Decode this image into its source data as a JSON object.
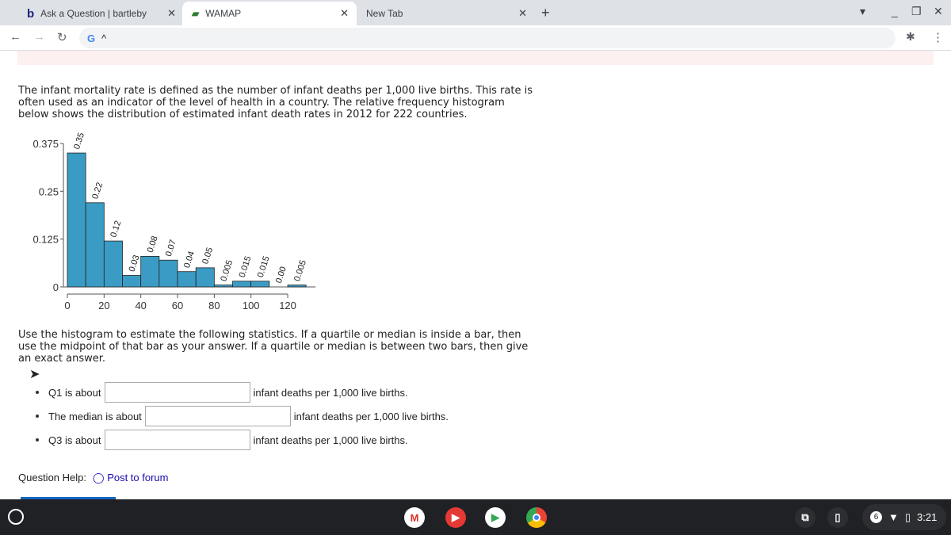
{
  "browser": {
    "tabs": [
      {
        "label": "Ask a Question | bartleby",
        "icon": "b"
      },
      {
        "label": "WAMAP",
        "active": true
      },
      {
        "label": "New Tab"
      }
    ],
    "omnibox": "^"
  },
  "intro": "The infant mortality rate is defined as the number of infant deaths per 1,000 live births. This rate is often used as an indicator of the level of health in a country. The relative frequency histogram below shows the distribution of estimated infant death rates in 2012 for 222 countries.",
  "chart_data": {
    "type": "bar",
    "bin_edges": [
      0,
      10,
      20,
      30,
      40,
      50,
      60,
      70,
      80,
      90,
      100,
      110,
      120,
      130
    ],
    "values": [
      0.35,
      0.22,
      0.12,
      0.03,
      0.08,
      0.07,
      0.04,
      0.05,
      0.005,
      0.015,
      0.015,
      0.0,
      0.005
    ],
    "labels": [
      "0.35",
      "0.22",
      "0.12",
      "0.03",
      "0.08",
      "0.07",
      "0.04",
      "0.05",
      "0.005",
      "0.015",
      "0.015",
      "0.00",
      "0.005"
    ],
    "yticks": [
      "0",
      "0.125",
      "0.25",
      "0.375"
    ],
    "xticks": [
      "0",
      "20",
      "40",
      "60",
      "80",
      "100",
      "120"
    ],
    "ylim": [
      0,
      0.375
    ],
    "xlim": [
      0,
      130
    ],
    "bar_color": "#3a9cc4"
  },
  "instructions": "Use the histogram to estimate the following statistics. If a quartile or median is inside a bar, then use the midpoint of that bar as your answer. If a quartile or median is between two bars, then give an exact answer.",
  "questions": [
    {
      "label": "Q1 is about",
      "value": "",
      "suffix": "infant deaths per 1,000 live births."
    },
    {
      "label": "The median is about",
      "value": "",
      "suffix": "infant deaths per 1,000 live births."
    },
    {
      "label": "Q3 is about",
      "value": "",
      "suffix": "infant deaths per 1,000 live births."
    }
  ],
  "help": {
    "label": "Question Help:",
    "link": "Post to forum"
  },
  "taskbar": {
    "badge": "6",
    "time": "3:21"
  }
}
